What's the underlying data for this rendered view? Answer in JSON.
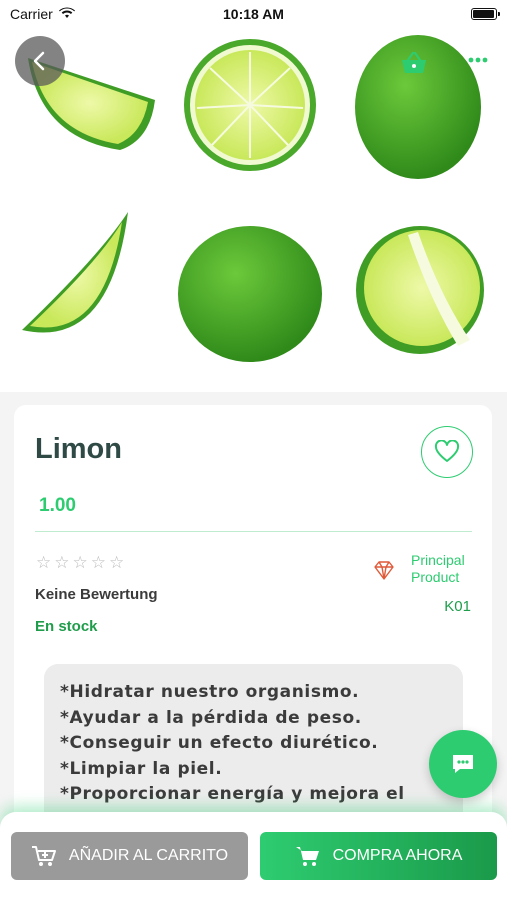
{
  "status_bar": {
    "carrier": "Carrier",
    "time": "10:18 AM",
    "battery_level": 0.95
  },
  "hero": {
    "back_icon": "chevron-left-icon",
    "basket_icon": "basket-icon",
    "more_icon": "more-dots-icon"
  },
  "product": {
    "name": "Limon",
    "price": "1.00",
    "rating_stars": 0,
    "rating_max": 5,
    "rating_text": "Keine Bewertung",
    "stock": "En stock",
    "badge_label": "Principal Product",
    "sku": "K01",
    "description": [
      "*Hidratar nuestro organismo.",
      "*Ayudar a la pérdida de peso.",
      "*Conseguir un efecto diurético.",
      "*Limpiar la piel.",
      "*Proporcionar energía y mejora el"
    ]
  },
  "actions": {
    "add_to_cart": "AÑADIR AL CARRITO",
    "buy_now": "COMPRA AHORA"
  },
  "colors": {
    "accent": "#2ecc71",
    "accent_dark": "#1a9a4a",
    "title": "#2f4a45",
    "badge": "#e05a3a",
    "cart_button": "#9a9a9a"
  }
}
